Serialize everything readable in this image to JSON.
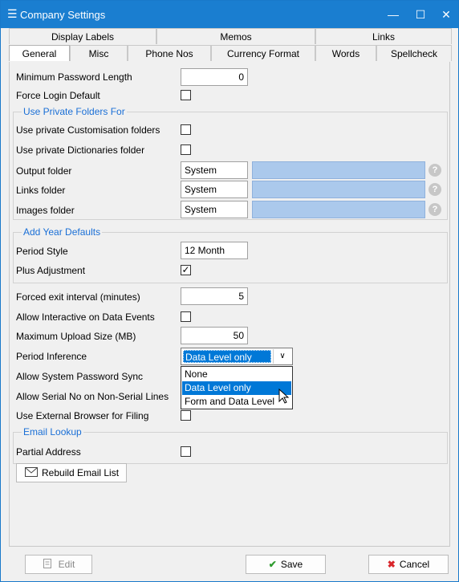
{
  "window": {
    "title": "Company Settings",
    "menu_icon": "hamburger-icon",
    "controls": {
      "minimize": "—",
      "maximize": "☐",
      "close": "✕"
    }
  },
  "tabs": {
    "row1": [
      "Display Labels",
      "Memos",
      "Links"
    ],
    "row2": [
      "General",
      "Misc",
      "Phone Nos",
      "Currency Format",
      "Words",
      "Spellcheck"
    ],
    "active": "General"
  },
  "general": {
    "min_password_length": {
      "label": "Minimum Password Length",
      "value": "0"
    },
    "force_login_default": {
      "label": "Force Login Default",
      "checked": false
    },
    "private_folders": {
      "title": "Use Private Folders For",
      "customisation": {
        "label": "Use private Customisation folders",
        "checked": false
      },
      "dictionaries": {
        "label": "Use private Dictionaries folder",
        "checked": false
      },
      "output": {
        "label": "Output folder",
        "value": "System"
      },
      "links": {
        "label": "Links folder",
        "value": "System"
      },
      "images": {
        "label": "Images folder",
        "value": "System"
      },
      "help_glyph": "?"
    },
    "year_defaults": {
      "title": "Add Year Defaults",
      "period_style": {
        "label": "Period Style",
        "value": "12 Month"
      },
      "plus_adjustment": {
        "label": "Plus Adjustment",
        "checked": true,
        "check_glyph": "✓"
      }
    },
    "forced_exit": {
      "label": "Forced exit interval (minutes)",
      "value": "5"
    },
    "allow_interactive": {
      "label": "Allow Interactive on Data Events",
      "checked": false
    },
    "max_upload": {
      "label": "Maximum Upload Size (MB)",
      "value": "50"
    },
    "period_inference": {
      "label": "Period Inference",
      "selected": "Data Level only",
      "options": [
        "None",
        "Data Level only",
        "Form and Data Level"
      ],
      "highlighted": "Data Level only"
    },
    "allow_system_password_sync": {
      "label": "Allow System Password Sync"
    },
    "allow_serial_no": {
      "label": "Allow Serial No on Non-Serial Lines"
    },
    "use_external_browser": {
      "label": "Use External Browser for Filing",
      "checked": false
    },
    "email_lookup": {
      "title": "Email Lookup",
      "partial_address": {
        "label": "Partial Address",
        "checked": false
      }
    },
    "rebuild_email_list": "Rebuild Email List"
  },
  "footer": {
    "edit": "Edit",
    "save": "Save",
    "cancel": "Cancel"
  },
  "colors": {
    "titlebar": "#1a7ed0",
    "group_title": "#1a6fd6",
    "folder_field": "#abc9ec",
    "selection": "#0078d7",
    "save_check": "#2e9b2e",
    "cancel_x": "#d9262b"
  }
}
